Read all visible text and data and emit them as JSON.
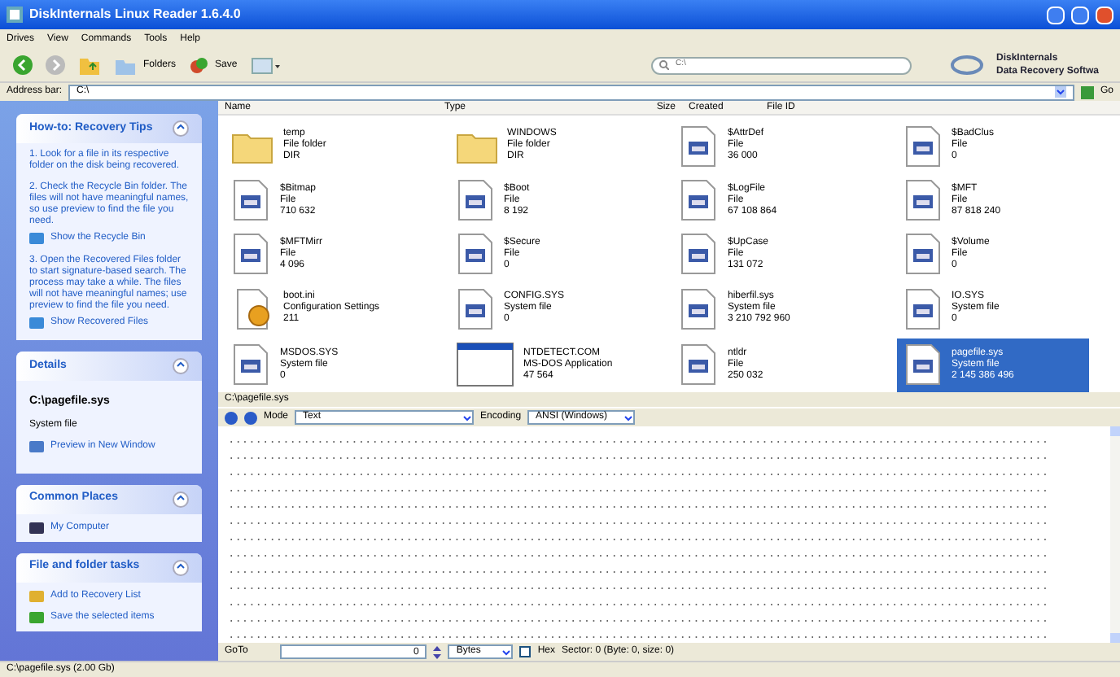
{
  "window": {
    "title": "DiskInternals Linux Reader 1.6.4.0"
  },
  "menu": [
    "Drives",
    "View",
    "Commands",
    "Tools",
    "Help"
  ],
  "toolbar": {
    "folders": "Folders",
    "save": "Save",
    "search": {
      "value": "C:\\"
    },
    "brand": [
      "DiskInternals",
      "Data Recovery Softwa"
    ]
  },
  "address_bar": {
    "label": "Address bar:",
    "value": "C:\\",
    "go": "Go"
  },
  "tips": {
    "title": "How-to: Recovery Tips",
    "steps": [
      {
        "text": "1. Look for a file in its respective folder on the disk being recovered."
      },
      {
        "text": "2. Check the Recycle Bin folder. The files will not have meaningful names, so use preview to find the file you need.",
        "link": "Show the Recycle Bin"
      },
      {
        "text": "3. Open the Recovered Files folder to start signature-based search. The process may take a while. The files will not have meaningful names; use preview to find the file you need.",
        "link": "Show Recovered Files"
      }
    ]
  },
  "details": {
    "title": "Details",
    "name": "C:\\pagefile.sys",
    "type": "System file",
    "link": "Preview in New Window"
  },
  "common_places": {
    "title": "Common Places",
    "items": [
      "My Computer"
    ]
  },
  "tasks": {
    "title": "File and folder tasks",
    "items": [
      "Add to Recovery List",
      "Save the selected items"
    ]
  },
  "columns": [
    "Name",
    "Type",
    "Size",
    "Created",
    "File ID"
  ],
  "files": [
    {
      "kind": "folder",
      "name": "temp",
      "type": "File folder",
      "size": "DIR",
      "selected": false
    },
    {
      "kind": "folder",
      "name": "WINDOWS",
      "type": "File folder",
      "size": "DIR",
      "selected": false
    },
    {
      "kind": "file",
      "name": "$AttrDef",
      "type": "File",
      "size": "36 000",
      "selected": false
    },
    {
      "kind": "file",
      "name": "$BadClus",
      "type": "File",
      "size": "0",
      "selected": false
    },
    {
      "kind": "file",
      "name": "$Bitmap",
      "type": "File",
      "size": "710 632",
      "selected": false
    },
    {
      "kind": "file",
      "name": "$Boot",
      "type": "File",
      "size": "8 192",
      "selected": false
    },
    {
      "kind": "file",
      "name": "$LogFile",
      "type": "File",
      "size": "67 108 864",
      "selected": false
    },
    {
      "kind": "file",
      "name": "$MFT",
      "type": "File",
      "size": "87 818 240",
      "selected": false
    },
    {
      "kind": "file",
      "name": "$MFTMirr",
      "type": "File",
      "size": "4 096",
      "selected": false
    },
    {
      "kind": "file",
      "name": "$Secure",
      "type": "File",
      "size": "0",
      "selected": false
    },
    {
      "kind": "file",
      "name": "$UpCase",
      "type": "File",
      "size": "131 072",
      "selected": false
    },
    {
      "kind": "file",
      "name": "$Volume",
      "type": "File",
      "size": "0",
      "selected": false
    },
    {
      "kind": "config",
      "name": "boot.ini",
      "type": "Configuration Settings",
      "size": "211",
      "selected": false
    },
    {
      "kind": "file",
      "name": "CONFIG.SYS",
      "type": "System file",
      "size": "0",
      "selected": false
    },
    {
      "kind": "file",
      "name": "hiberfil.sys",
      "type": "System file",
      "size": "3 210 792 960",
      "selected": false
    },
    {
      "kind": "file",
      "name": "IO.SYS",
      "type": "System file",
      "size": "0",
      "selected": false
    },
    {
      "kind": "file",
      "name": "MSDOS.SYS",
      "type": "System file",
      "size": "0",
      "selected": false
    },
    {
      "kind": "app",
      "name": "NTDETECT.COM",
      "type": "MS-DOS Application",
      "size": "47 564",
      "selected": false
    },
    {
      "kind": "file",
      "name": "ntldr",
      "type": "File",
      "size": "250 032",
      "selected": false
    },
    {
      "kind": "file",
      "name": "pagefile.sys",
      "type": "System file",
      "size": "2 145 386 496",
      "selected": true
    }
  ],
  "preview": {
    "path": "C:\\pagefile.sys",
    "mode_label": "Mode",
    "mode": "Text",
    "encoding_label": "Encoding",
    "encoding": "ANSI (Windows)",
    "lines": [
      "........................................................................................................................",
      "........................................................................................................................",
      "........................................................................................................................",
      "........................................................................................................................",
      "........................................................................................................................",
      "........................................................................................................................",
      "........................................................................................................................",
      "........................................................................................................................",
      "........................................................................................................................",
      "........................................................................................................................",
      "........................................................................................................................",
      "........................................................................................................................",
      "........................................................................................................................"
    ]
  },
  "goto": {
    "label": "GoTo",
    "value": "0",
    "unit": "Bytes",
    "hex_label": "Hex",
    "hex": false,
    "sector": "Sector: 0 (Byte: 0, size: 0)"
  },
  "status_bar": "C:\\pagefile.sys (2.00 Gb)"
}
